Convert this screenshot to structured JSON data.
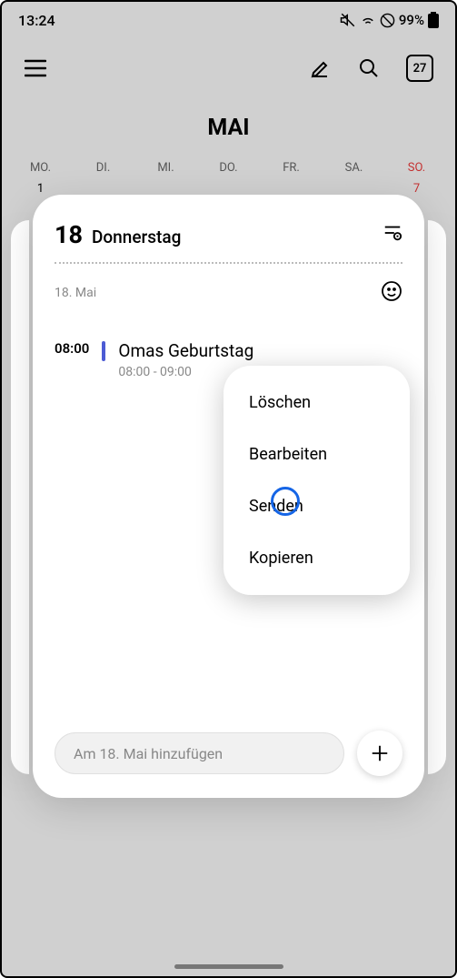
{
  "status": {
    "time": "13:24",
    "battery": "99%"
  },
  "header": {
    "today_date": "27"
  },
  "month": {
    "title": "MAI"
  },
  "weekdays": [
    "MO.",
    "DI.",
    "MI.",
    "DO.",
    "FR.",
    "SA.",
    "SO."
  ],
  "dates_row": [
    "1",
    "",
    "",
    "",
    "",
    "",
    "7"
  ],
  "day": {
    "number": "18",
    "name": "Donnerstag",
    "date_line": "18. Mai"
  },
  "event": {
    "time": "08:00",
    "title": "Omas Geburtstag",
    "sub": "08:00 - 09:00"
  },
  "add_placeholder": "Am 18. Mai hinzufügen",
  "menu": {
    "delete": "Löschen",
    "edit": "Bearbeiten",
    "send": "Senden",
    "copy": "Kopieren"
  }
}
